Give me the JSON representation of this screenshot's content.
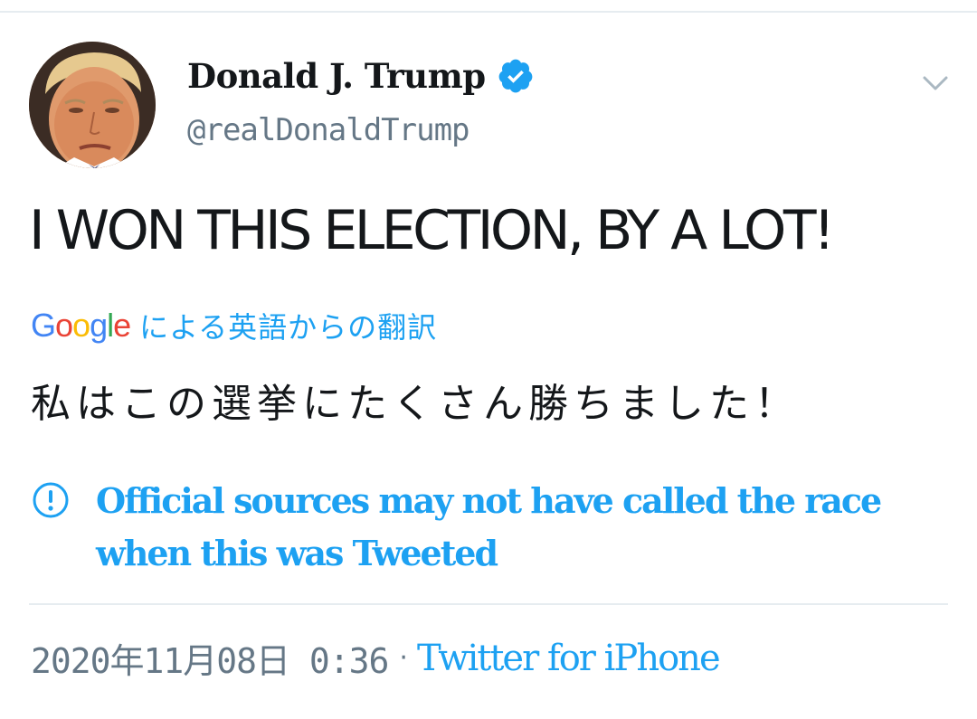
{
  "user": {
    "display_name": "Donald J. Trump",
    "handle": "@realDonaldTrump",
    "verified": true,
    "avatar_icon": "profile-photo"
  },
  "tweet": {
    "text": "I WON THIS ELECTION, BY A LOT!"
  },
  "translation": {
    "provider": "Google",
    "label": "による英語からの翻訳",
    "text": "私はこの選挙にたくさん勝ちました！"
  },
  "notice": {
    "icon": "exclamation-circle-icon",
    "text": "Official sources may not have called the race when this was Tweeted"
  },
  "meta": {
    "timestamp": "2020年11月08日 0:36",
    "separator": "·",
    "source": "Twitter for iPhone"
  },
  "colors": {
    "link_blue": "#1da1f2",
    "secondary_gray": "#657786",
    "text": "#14171a",
    "divider": "#e6ecf0"
  }
}
